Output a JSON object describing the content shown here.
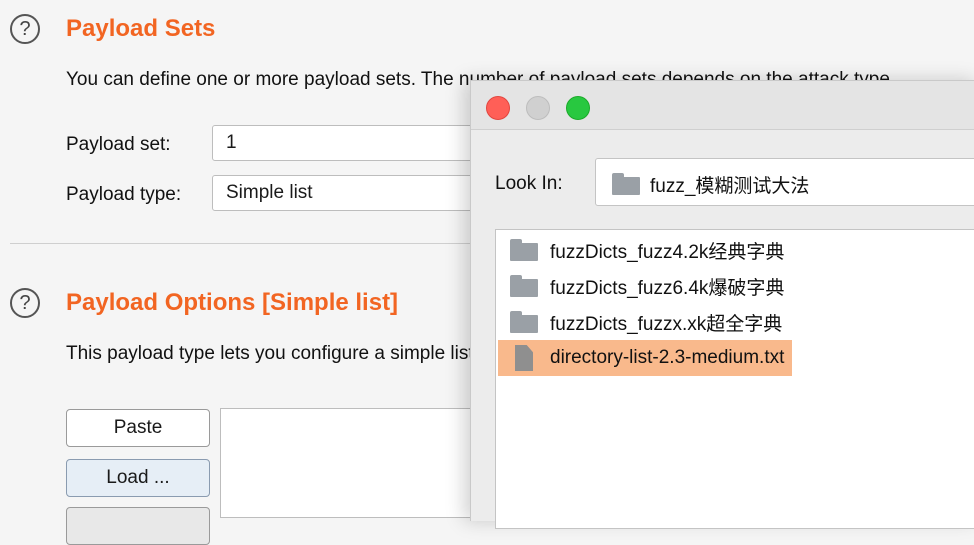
{
  "payload_sets": {
    "title": "Payload Sets",
    "description": "You can define one or more payload sets. The number of payload sets depends on the attack type",
    "set_label": "Payload set:",
    "set_value": "1",
    "type_label": "Payload type:",
    "type_value": "Simple list"
  },
  "payload_options": {
    "title": "Payload Options [Simple list]",
    "description": "This payload type lets you configure a simple list",
    "paste_label": "Paste",
    "load_label": "Load ..."
  },
  "help_glyph": "?",
  "dialog": {
    "lookin_label": "Look In:",
    "lookin_value": "fuzz_模糊测试大法",
    "files": [
      {
        "name": "fuzzDicts_fuzz4.2k经典字典",
        "kind": "folder"
      },
      {
        "name": "fuzzDicts_fuzz6.4k爆破字典",
        "kind": "folder"
      },
      {
        "name": "fuzzDicts_fuzzx.xk超全字典",
        "kind": "folder"
      },
      {
        "name": "directory-list-2.3-medium.txt",
        "kind": "file",
        "selected": true
      }
    ]
  },
  "colors": {
    "accent": "#f26522",
    "selection": "#f9b98c"
  }
}
